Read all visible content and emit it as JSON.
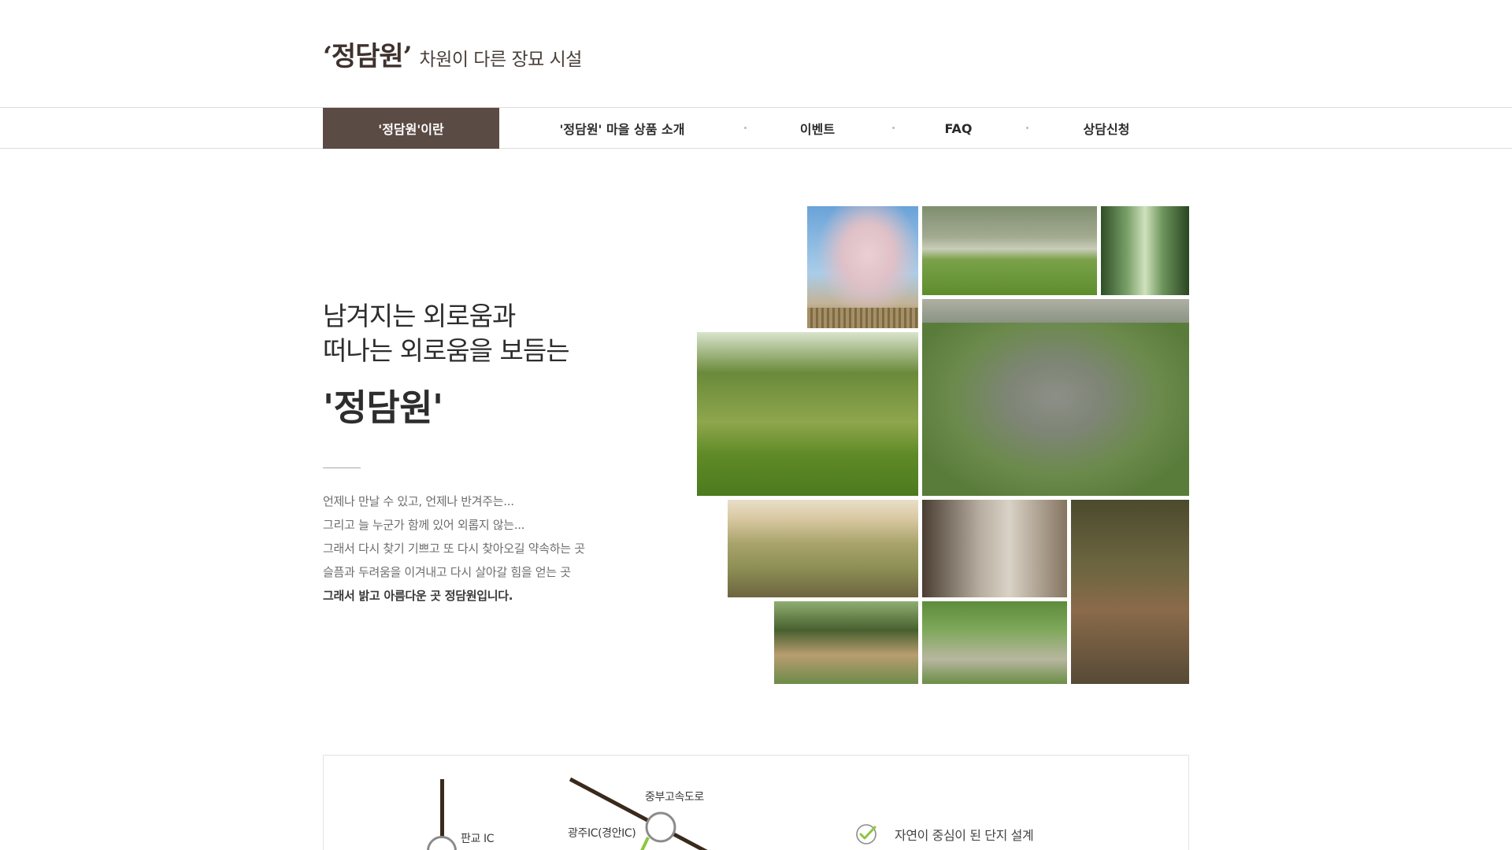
{
  "header": {
    "brand": "‘정담원’",
    "tagline": "차원이 다른 장묘 시설"
  },
  "nav": {
    "items": [
      {
        "label": "'정담원'이란",
        "active": true
      },
      {
        "label": "'정담원' 마을 상품 소개",
        "active": false
      },
      {
        "label": "이벤트",
        "active": false
      },
      {
        "label": "FAQ",
        "active": false
      },
      {
        "label": "상담신청",
        "active": false
      }
    ]
  },
  "intro": {
    "line1": "남겨지는 외로움과",
    "line2": "떠나는 외로움을 보듬는",
    "brand": "'정담원'"
  },
  "description": [
    "언제나 만날 수 있고, 언제나 반겨주는...",
    "그리고 늘 누군가 함께 있어 외롭지 않는...",
    "그래서 다시 찾기 기쁘고 또 다시 찾아오길 약속하는 곳",
    "슬픔과 두려움을 이겨내고 다시 살아갈 힘을 얻는 곳",
    "그래서 밝고 아름다운 곳 정담원입니다."
  ],
  "map": {
    "label_highway": "중부고속도로",
    "label_gwangju_ic": "광주IC(경안IC)",
    "label_pangyo_ic": "판교 IC"
  },
  "features": {
    "item1": "자연이 중심이 된 단지 설계"
  },
  "colors": {
    "nav_active_bg": "#5b4b45",
    "brand_text": "#3e322c",
    "road": "#3a2a1c",
    "check_green": "#8cc63f"
  }
}
